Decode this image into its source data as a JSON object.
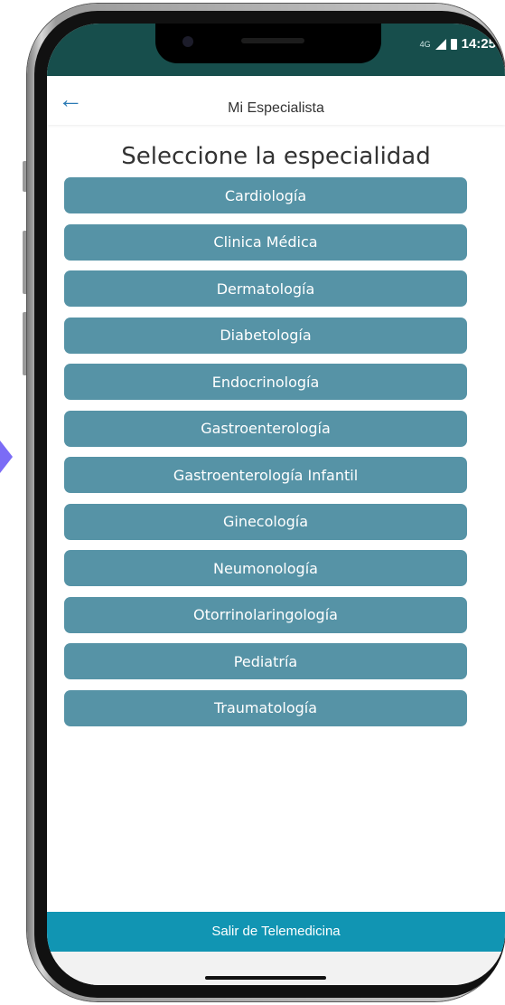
{
  "status_bar": {
    "network": "4G",
    "time": "14:25"
  },
  "app_bar": {
    "title": "Mi Especialista"
  },
  "page": {
    "title": "Seleccione la especialidad"
  },
  "specialties": [
    {
      "label": "Cardiología"
    },
    {
      "label": "Clinica Médica"
    },
    {
      "label": "Dermatología"
    },
    {
      "label": "Diabetología"
    },
    {
      "label": "Endocrinología"
    },
    {
      "label": "Gastroenterología"
    },
    {
      "label": "Gastroenterología Infantil"
    },
    {
      "label": "Ginecología"
    },
    {
      "label": "Neumonología"
    },
    {
      "label": "Otorrinolaringología"
    },
    {
      "label": "Pediatría"
    },
    {
      "label": "Traumatología"
    }
  ],
  "footer": {
    "exit_label": "Salir de Telemedicina"
  },
  "colors": {
    "status_bar": "#174e4c",
    "specialty_button": "#5693a6",
    "exit_bar": "#1195b3",
    "back_arrow": "#2b7bb5",
    "side_arrow": "#7b6cf6"
  }
}
